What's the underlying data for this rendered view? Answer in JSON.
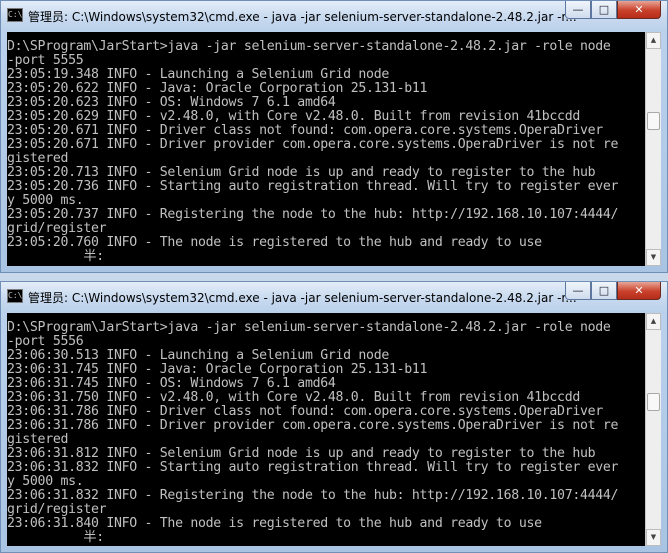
{
  "windows": [
    {
      "title": "管理员: C:\\Windows\\system32\\cmd.exe - java  -jar selenium-server-standalone-2.48.2.jar -r...",
      "icon": "cmd-icon",
      "lines": [
        "D:\\SProgram\\JarStart>java -jar selenium-server-standalone-2.48.2.jar -role node",
        "-port 5555",
        "23:05:19.348 INFO - Launching a Selenium Grid node",
        "23:05:20.622 INFO - Java: Oracle Corporation 25.131-b11",
        "23:05:20.623 INFO - OS: Windows 7 6.1 amd64",
        "23:05:20.629 INFO - v2.48.0, with Core v2.48.0. Built from revision 41bccdd",
        "23:05:20.671 INFO - Driver class not found: com.opera.core.systems.OperaDriver",
        "23:05:20.671 INFO - Driver provider com.opera.core.systems.OperaDriver is not re",
        "gistered",
        "23:05:20.713 INFO - Selenium Grid node is up and ready to register to the hub",
        "23:05:20.736 INFO - Starting auto registration thread. Will try to register ever",
        "y 5000 ms.",
        "23:05:20.737 INFO - Registering the node to the hub: http://192.168.10.107:4444/",
        "grid/register",
        "23:05:20.760 INFO - The node is registered to the hub and ready to use",
        "          半:"
      ]
    },
    {
      "title": "管理员: C:\\Windows\\system32\\cmd.exe - java  -jar selenium-server-standalone-2.48.2.jar -r...",
      "icon": "cmd-icon",
      "lines": [
        "D:\\SProgram\\JarStart>java -jar selenium-server-standalone-2.48.2.jar -role node",
        "-port 5556",
        "23:06:30.513 INFO - Launching a Selenium Grid node",
        "23:06:31.745 INFO - Java: Oracle Corporation 25.131-b11",
        "23:06:31.745 INFO - OS: Windows 7 6.1 amd64",
        "23:06:31.750 INFO - v2.48.0, with Core v2.48.0. Built from revision 41bccdd",
        "23:06:31.786 INFO - Driver class not found: com.opera.core.systems.OperaDriver",
        "23:06:31.786 INFO - Driver provider com.opera.core.systems.OperaDriver is not re",
        "gistered",
        "23:06:31.812 INFO - Selenium Grid node is up and ready to register to the hub",
        "23:06:31.832 INFO - Starting auto registration thread. Will try to register ever",
        "y 5000 ms.",
        "23:06:31.832 INFO - Registering the node to the hub: http://192.168.10.107:4444/",
        "grid/register",
        "23:06:31.840 INFO - The node is registered to the hub and ready to use",
        "          半:"
      ]
    }
  ],
  "controls": {
    "minimize": "—",
    "maximize": "□",
    "close": "✕"
  },
  "scrollbar": {
    "up": "▲",
    "down": "▼"
  }
}
